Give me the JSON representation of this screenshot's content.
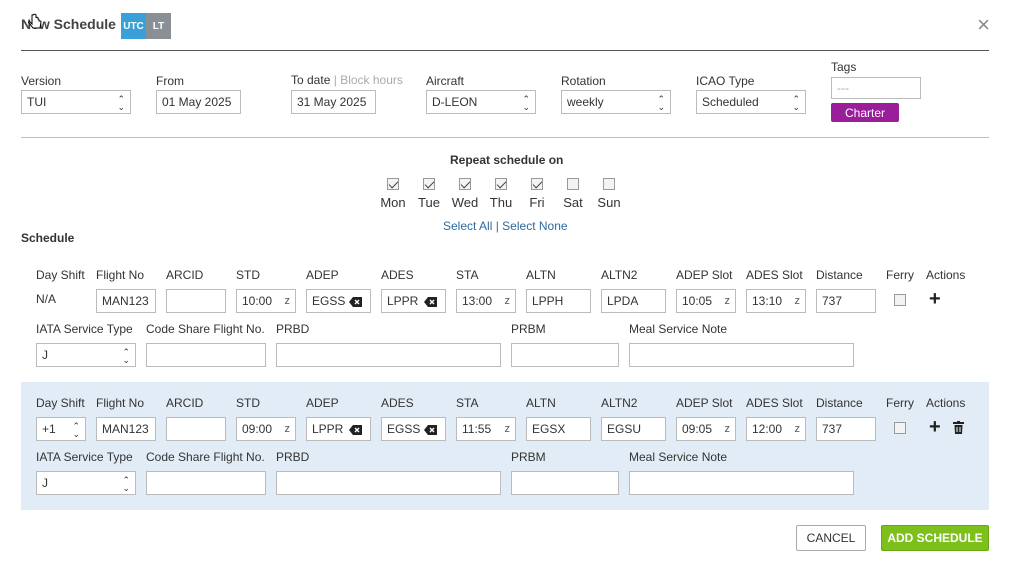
{
  "header": {
    "title": "New Schedule",
    "utc": "UTC",
    "lt": "LT",
    "close": "×",
    "utc_color": "#3aa0d8",
    "lt_color": "#8a8f96"
  },
  "form": {
    "version_label": "Version",
    "version_value": "TUI",
    "from_label": "From",
    "from_value": "01 May 2025",
    "to_label": "To date",
    "to_sep": "|",
    "block_hours": "Block hours",
    "to_value": "31 May 2025",
    "aircraft_label": "Aircraft",
    "aircraft_value": "D-LEON",
    "rotation_label": "Rotation",
    "rotation_value": "weekly",
    "icao_label": "ICAO Type",
    "icao_value": "Scheduled",
    "tags_label": "Tags",
    "tags_placeholder": "---",
    "tag": "Charter",
    "tag_color": "#9a1d9a"
  },
  "repeat": {
    "label": "Repeat schedule on",
    "days": [
      {
        "label": "Mon",
        "checked": true
      },
      {
        "label": "Tue",
        "checked": true
      },
      {
        "label": "Wed",
        "checked": true
      },
      {
        "label": "Thu",
        "checked": true
      },
      {
        "label": "Fri",
        "checked": true
      },
      {
        "label": "Sat",
        "checked": false
      },
      {
        "label": "Sun",
        "checked": false
      }
    ],
    "select_all": "Select All",
    "sep": "|",
    "select_none": "Select None"
  },
  "schedule_label": "Schedule",
  "columns": {
    "day_shift": "Day Shift",
    "flight_no": "Flight No",
    "arcid": "ARCID",
    "std": "STD",
    "adep": "ADEP",
    "ades": "ADES",
    "sta": "STA",
    "altn": "ALTN",
    "altn2": "ALTN2",
    "adep_slot": "ADEP Slot",
    "ades_slot": "ADES Slot",
    "distance": "Distance",
    "ferry": "Ferry",
    "actions": "Actions",
    "iata": "IATA Service Type",
    "codeshare": "Code Share Flight No.",
    "prbd": "PRBD",
    "prbm": "PRBM",
    "meal": "Meal Service Note",
    "z": "z"
  },
  "rows": [
    {
      "day_shift": "N/A",
      "flight_no": "MAN123",
      "arcid": "",
      "std": "10:00",
      "adep": "EGSS",
      "ades": "LPPR",
      "sta": "13:00",
      "altn": "LPPH",
      "altn2": "LPDA",
      "adep_slot": "10:05",
      "ades_slot": "13:10",
      "distance": "737",
      "iata": "J",
      "codeshare": "",
      "prbd": "",
      "prbm": "",
      "meal": ""
    },
    {
      "day_shift": "+1",
      "flight_no": "MAN123",
      "arcid": "",
      "std": "09:00",
      "adep": "LPPR",
      "ades": "EGSS",
      "sta": "11:55",
      "altn": "EGSX",
      "altn2": "EGSU",
      "adep_slot": "09:05",
      "ades_slot": "12:00",
      "distance": "737",
      "iata": "J",
      "codeshare": "",
      "prbd": "",
      "prbm": "",
      "meal": ""
    }
  ],
  "buttons": {
    "cancel": "CANCEL",
    "add": "ADD SCHEDULE",
    "add_color": "#7dbf1b"
  }
}
